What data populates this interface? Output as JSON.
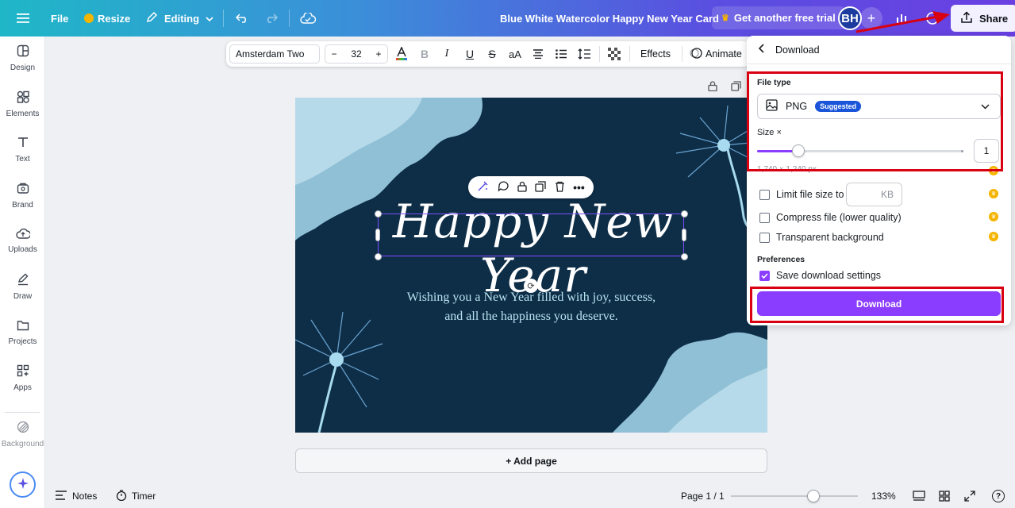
{
  "topbar": {
    "file": "File",
    "resize": "Resize",
    "editing": "Editing",
    "doc_title": "Blue White Watercolor Happy New Year  Card",
    "trial": "Get another free trial",
    "avatar": "BH",
    "share": "Share"
  },
  "sidebar": {
    "items": [
      {
        "label": "Design",
        "icon": "design-icon"
      },
      {
        "label": "Elements",
        "icon": "elements-icon"
      },
      {
        "label": "Text",
        "icon": "text-icon"
      },
      {
        "label": "Brand",
        "icon": "brand-icon"
      },
      {
        "label": "Uploads",
        "icon": "uploads-icon"
      },
      {
        "label": "Draw",
        "icon": "draw-icon"
      },
      {
        "label": "Projects",
        "icon": "projects-icon"
      },
      {
        "label": "Apps",
        "icon": "apps-icon"
      }
    ],
    "background": "Background"
  },
  "text_toolbar": {
    "font": "Amsterdam Two",
    "minus": "−",
    "size": "32",
    "plus": "+",
    "effects": "Effects",
    "animate": "Animate"
  },
  "canvas": {
    "title": "Happy New Year",
    "subtitle_line1": "Wishing you a New Year filled with joy, success,",
    "subtitle_line2": "and all the happiness you deserve.",
    "bg_color": "#0e2e48"
  },
  "add_page": "+ Add page",
  "bottombar": {
    "notes": "Notes",
    "timer": "Timer",
    "page": "Page 1 / 1",
    "zoom": "133%",
    "zoom_fraction": 0.65,
    "help": "?"
  },
  "download_panel": {
    "title": "Download",
    "file_type_label": "File type",
    "file_type": "PNG",
    "suggested": "Suggested",
    "size_label": "Size ×",
    "size_value": "1",
    "size_fraction": 0.2,
    "dims": "1,740 × 1,240 px",
    "limit_size": "Limit file size to",
    "kb": "KB",
    "compress": "Compress file (lower quality)",
    "transparent": "Transparent background",
    "preferences": "Preferences",
    "save_settings": "Save download settings",
    "download": "Download"
  },
  "colors": {
    "accent": "#8b3dff",
    "highlight": "#d90012"
  }
}
